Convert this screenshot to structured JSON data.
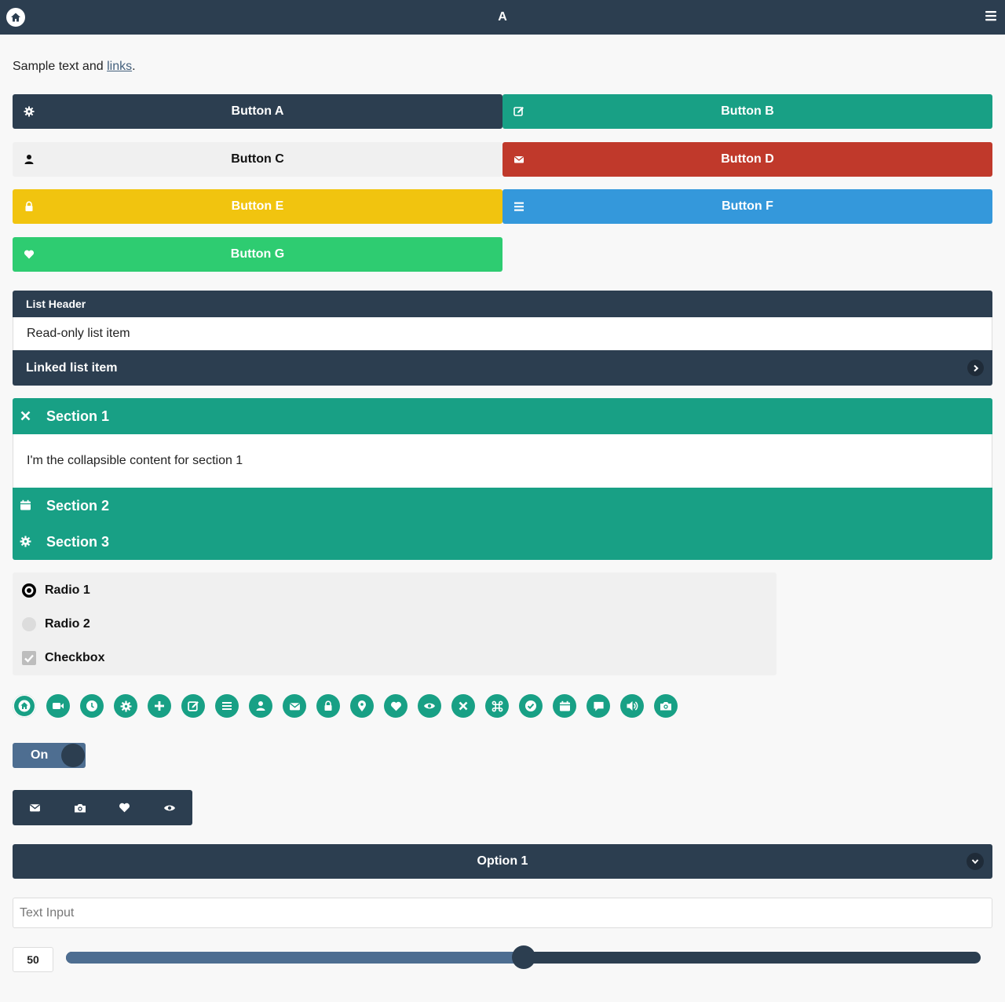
{
  "header": {
    "title": "A",
    "home_icon": "home-icon",
    "menu_icon": "bars-icon"
  },
  "intro": {
    "text_before": "Sample text and ",
    "link_text": "links",
    "text_after": "."
  },
  "buttons": [
    {
      "label": "Button A",
      "icon": "gear-icon",
      "color": "#2c3e50"
    },
    {
      "label": "Button B",
      "icon": "edit-icon",
      "color": "#18a085"
    },
    {
      "label": "Button C",
      "icon": "user-icon",
      "color": "#f0f0f0"
    },
    {
      "label": "Button D",
      "icon": "mail-icon",
      "color": "#c0392b"
    },
    {
      "label": "Button E",
      "icon": "lock-icon",
      "color": "#f1c40f"
    },
    {
      "label": "Button F",
      "icon": "bars-icon",
      "color": "#3498db"
    },
    {
      "label": "Button G",
      "icon": "heart-icon",
      "color": "#2ecc71"
    }
  ],
  "list": {
    "header": "List Header",
    "readonly_item": "Read-only list item",
    "linked_item": "Linked list item"
  },
  "collapsibles": [
    {
      "title": "Section 1",
      "icon": "close-icon",
      "expanded": true,
      "content": "I'm the collapsible content for section 1"
    },
    {
      "title": "Section 2",
      "icon": "calendar-icon",
      "expanded": false
    },
    {
      "title": "Section 3",
      "icon": "gear-icon",
      "expanded": false
    }
  ],
  "form_controls": {
    "radio1": {
      "label": "Radio 1",
      "checked": true
    },
    "radio2": {
      "label": "Radio 2",
      "checked": false
    },
    "checkbox": {
      "label": "Checkbox",
      "checked": true
    }
  },
  "icon_buttons": [
    "home-icon",
    "video-icon",
    "clock-icon",
    "gear-icon",
    "plus-icon",
    "edit-icon",
    "bars-icon",
    "user-icon",
    "mail-icon",
    "lock-icon",
    "location-icon",
    "heart-icon",
    "eye-icon",
    "close-icon",
    "command-icon",
    "check-icon",
    "calendar-icon",
    "comment-icon",
    "audio-icon",
    "camera-icon"
  ],
  "flipswitch": {
    "label": "On",
    "state": true
  },
  "navbar": {
    "items": [
      "mail-icon",
      "camera-icon",
      "heart-icon",
      "eye-icon"
    ]
  },
  "select": {
    "selected": "Option 1"
  },
  "text_input": {
    "placeholder": "Text Input",
    "value": ""
  },
  "slider": {
    "value": "50",
    "min": 0,
    "max": 100
  },
  "colors": {
    "accent": "#18a085",
    "dark": "#2c3e50",
    "slider_fill": "#4e6e91"
  }
}
